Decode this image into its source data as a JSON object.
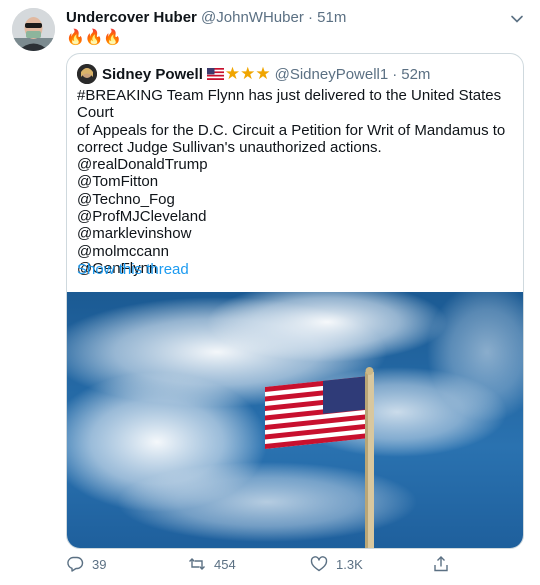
{
  "tweet": {
    "author_name": "Undercover Huber",
    "author_handle": "@JohnWHuber",
    "separator": "·",
    "time": "51m",
    "text": "🔥🔥🔥"
  },
  "quote": {
    "author_name": "Sidney Powell",
    "stars": "★★★",
    "author_handle": "@SidneyPowell1",
    "separator": "·",
    "time": "52m",
    "lines": [
      "#BREAKING  Team Flynn has just delivered to the United States Court",
      "of Appeals for the D.C. Circuit a Petition for Writ of Mandamus to",
      "correct Judge Sullivan's unauthorized actions."
    ],
    "mentions": [
      "@realDonaldTrump",
      "@TomFitton",
      "@Techno_Fog",
      "@ProfMJCleveland",
      "@marklevinshow",
      "@molmccann",
      "@GenFlynn"
    ],
    "show_thread": "Show this thread"
  },
  "actions": {
    "replies": "39",
    "retweets": "454",
    "likes": "1.3K"
  },
  "colors": {
    "link": "#1d9bf0",
    "muted": "#5b7083",
    "border": "#cfd9de",
    "star": "#f0a500"
  },
  "icons": {
    "caret": "chevron-down-icon",
    "reply": "reply-icon",
    "retweet": "retweet-icon",
    "like": "heart-icon",
    "share": "share-icon"
  }
}
